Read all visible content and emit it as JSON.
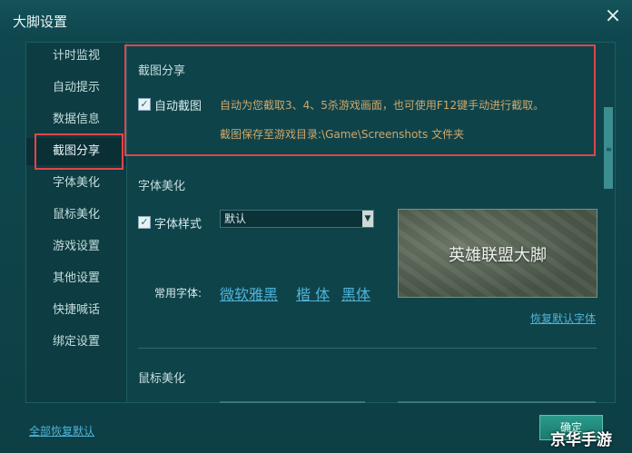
{
  "window": {
    "title": "大脚设置",
    "close_icon": "×"
  },
  "sidebar": {
    "items": [
      {
        "label": "计时监视"
      },
      {
        "label": "自动提示"
      },
      {
        "label": "数据信息"
      },
      {
        "label": "截图分享",
        "active": true
      },
      {
        "label": "字体美化"
      },
      {
        "label": "鼠标美化"
      },
      {
        "label": "游戏设置"
      },
      {
        "label": "其他设置"
      },
      {
        "label": "快捷喊话"
      },
      {
        "label": "绑定设置"
      }
    ]
  },
  "screenshot_share": {
    "title": "截图分享",
    "auto_screenshot_label": "自动截图",
    "checked": true,
    "desc_line1": "自动为您截取3、4、5杀游戏画面，也可使用F12键手动进行截取。",
    "desc_line2": "截图保存至游戏目录:\\Game\\Screenshots 文件夹"
  },
  "font_beautify": {
    "title": "字体美化",
    "font_style_label": "字体样式",
    "checked": true,
    "select_value": "默认",
    "common_fonts_label": "常用字体:",
    "fonts": [
      "微软雅黑",
      "楷 体",
      "黑体"
    ],
    "preview_text": "英雄联盟大脚",
    "restore_default_font": "恢复默认字体"
  },
  "mouse_beautify": {
    "title": "鼠标美化"
  },
  "footer": {
    "restore_all": "全部恢复默认",
    "ok_button": "确定",
    "watermark": "京华手游"
  },
  "colors": {
    "accent_red": "#e0454a",
    "link_blue": "#4fb3d8",
    "desc_text": "#cfa86a"
  }
}
